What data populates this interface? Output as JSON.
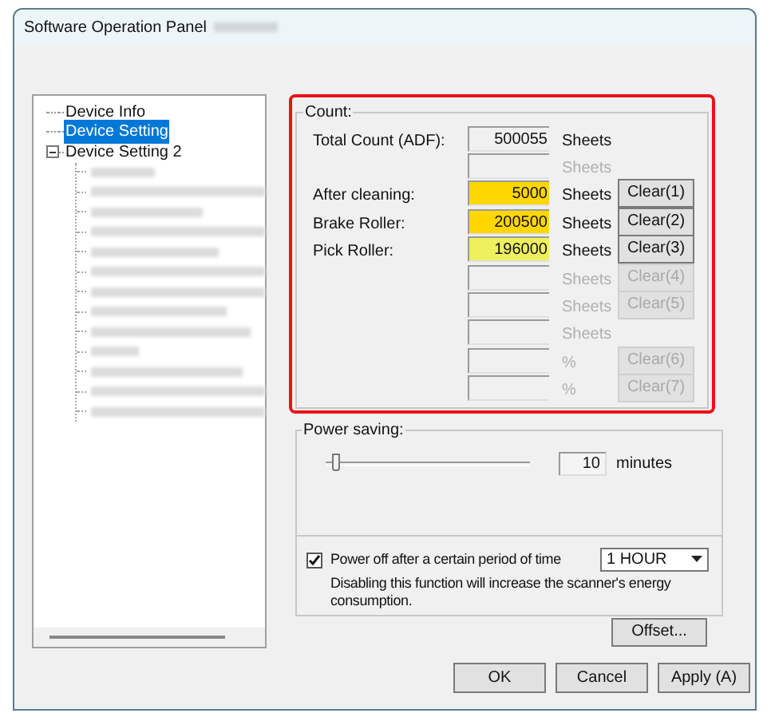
{
  "window": {
    "title": "Software Operation Panel",
    "title_suffix_redacted": true
  },
  "tree": {
    "items": [
      {
        "label": "Device Info",
        "selected": false
      },
      {
        "label": "Device Setting",
        "selected": true
      },
      {
        "label": "Device Setting 2",
        "selected": false,
        "expanded": true,
        "children": [
          {
            "kind": "redacted"
          },
          {
            "kind": "redacted"
          },
          {
            "kind": "redacted"
          },
          {
            "kind": "redacted"
          },
          {
            "kind": "redacted"
          },
          {
            "kind": "redacted"
          },
          {
            "kind": "redacted"
          },
          {
            "kind": "redacted"
          },
          {
            "kind": "redacted"
          },
          {
            "kind": "redacted"
          },
          {
            "kind": "redacted"
          },
          {
            "kind": "redacted"
          },
          {
            "kind": "redacted"
          }
        ]
      }
    ]
  },
  "count": {
    "title": "Count:",
    "highlighted": true,
    "rows": [
      {
        "label": "Total Count (ADF):",
        "value": "500055",
        "unit": "Sheets",
        "disabled": false
      },
      {
        "unit": "Sheets",
        "disabled": true
      },
      {
        "label": "After cleaning:",
        "value": "5000",
        "color": "#ffd700",
        "unit": "Sheets",
        "disabled": false,
        "button": {
          "label": "Clear(1)",
          "disabled": false
        }
      },
      {
        "label": "Brake Roller:",
        "value": "200500",
        "color": "#ffd700",
        "unit": "Sheets",
        "disabled": false,
        "button": {
          "label": "Clear(2)",
          "disabled": false
        }
      },
      {
        "label": "Pick Roller:",
        "value": "196000",
        "color": "#eef060",
        "unit": "Sheets",
        "disabled": false,
        "button": {
          "label": "Clear(3)",
          "disabled": false
        }
      },
      {
        "unit": "Sheets",
        "disabled": true,
        "button": {
          "label": "Clear(4)",
          "disabled": true
        }
      },
      {
        "unit": "Sheets",
        "disabled": true,
        "button": {
          "label": "Clear(5)",
          "disabled": true
        }
      },
      {
        "unit": "Sheets",
        "disabled": true
      },
      {
        "unit": "%",
        "disabled": true,
        "button": {
          "label": "Clear(6)",
          "disabled": true
        }
      },
      {
        "unit": "%",
        "disabled": true,
        "button": {
          "label": "Clear(7)",
          "disabled": true
        }
      }
    ]
  },
  "power_saving": {
    "title": "Power saving:",
    "level": 0.03,
    "minutes_value": "10",
    "minutes_unit": "minutes",
    "power_off": {
      "checked": true,
      "label": "Power off after a certain period of time",
      "dropdown_value": "1 HOUR",
      "note": "Disabling this function will increase the scanner's energy consumption."
    }
  },
  "offset_button": "Offset...",
  "buttons": [
    "OK",
    "Cancel",
    "Apply (A)"
  ]
}
